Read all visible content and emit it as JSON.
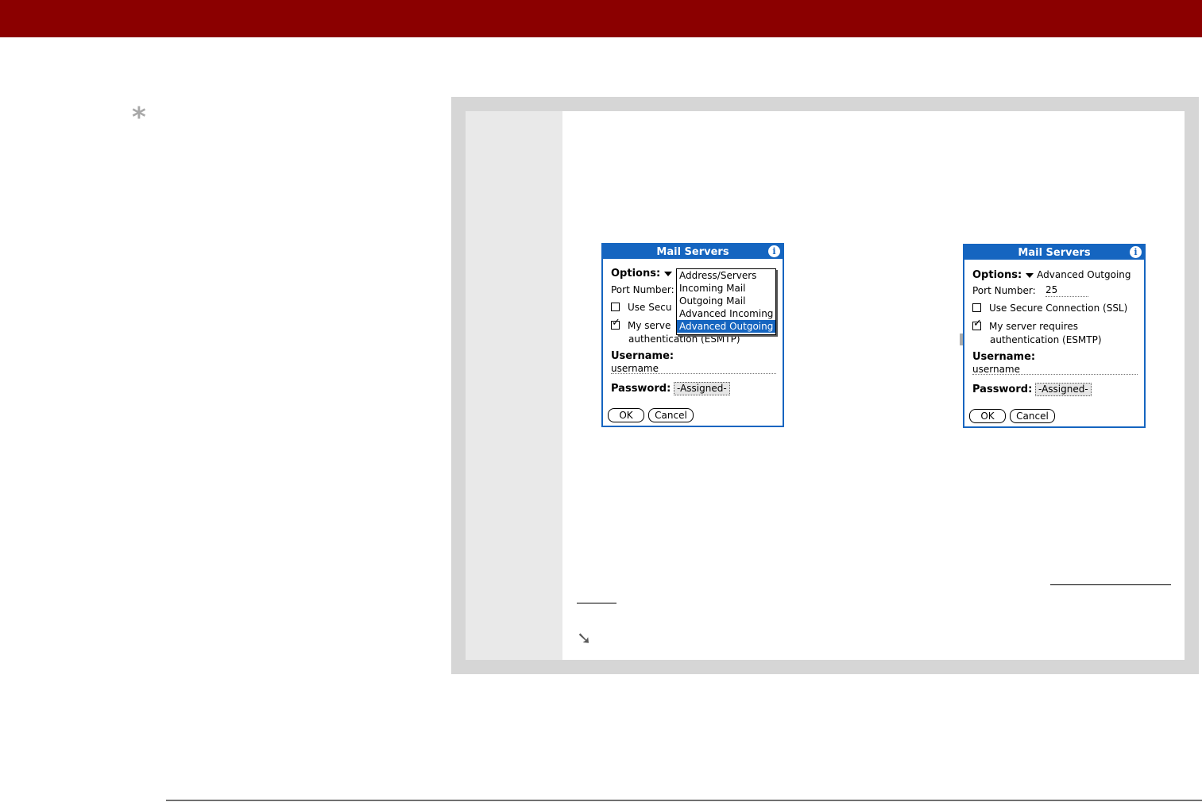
{
  "tip": {
    "icon": "asterisk-icon",
    "symbol": "*"
  },
  "colors": {
    "header_bar": "#8b0000",
    "palm_blue": "#1565c0",
    "panel_gray": "#d6d6d6",
    "arrow_gray": "#ababab"
  },
  "dialogs": [
    {
      "title": "Mail Servers",
      "options_label": "Options:",
      "port_label": "Port Number:",
      "ssl_label": "Use Secu",
      "ssl_checked": false,
      "auth_line1": "My serve",
      "auth_line2": "authentication (ESMTP)",
      "auth_checked": true,
      "username_label": "Username:",
      "username_value": "username",
      "password_label": "Password:",
      "password_value": "-Assigned-",
      "ok_label": "OK",
      "cancel_label": "Cancel",
      "dropdown_items": [
        "Address/Servers",
        "Incoming Mail",
        "Outgoing Mail",
        "Advanced Incoming",
        "Advanced Outgoing"
      ],
      "dropdown_selected": "Advanced Outgoing"
    },
    {
      "title": "Mail Servers",
      "options_label": "Options:",
      "options_value": "Advanced Outgoing",
      "port_label": "Port Number:",
      "port_value": "25",
      "ssl_label": "Use Secure Connection (SSL)",
      "ssl_checked": false,
      "auth_line1": "My server requires",
      "auth_line2": "authentication (ESMTP)",
      "auth_checked": true,
      "username_label": "Username:",
      "username_value": "username",
      "password_label": "Password:",
      "password_value": "-Assigned-",
      "ok_label": "OK",
      "cancel_label": "Cancel"
    }
  ],
  "transition_arrow": "right-arrow-icon",
  "continue_icon": {
    "name": "continue-arrow-icon",
    "symbol": "➘"
  }
}
